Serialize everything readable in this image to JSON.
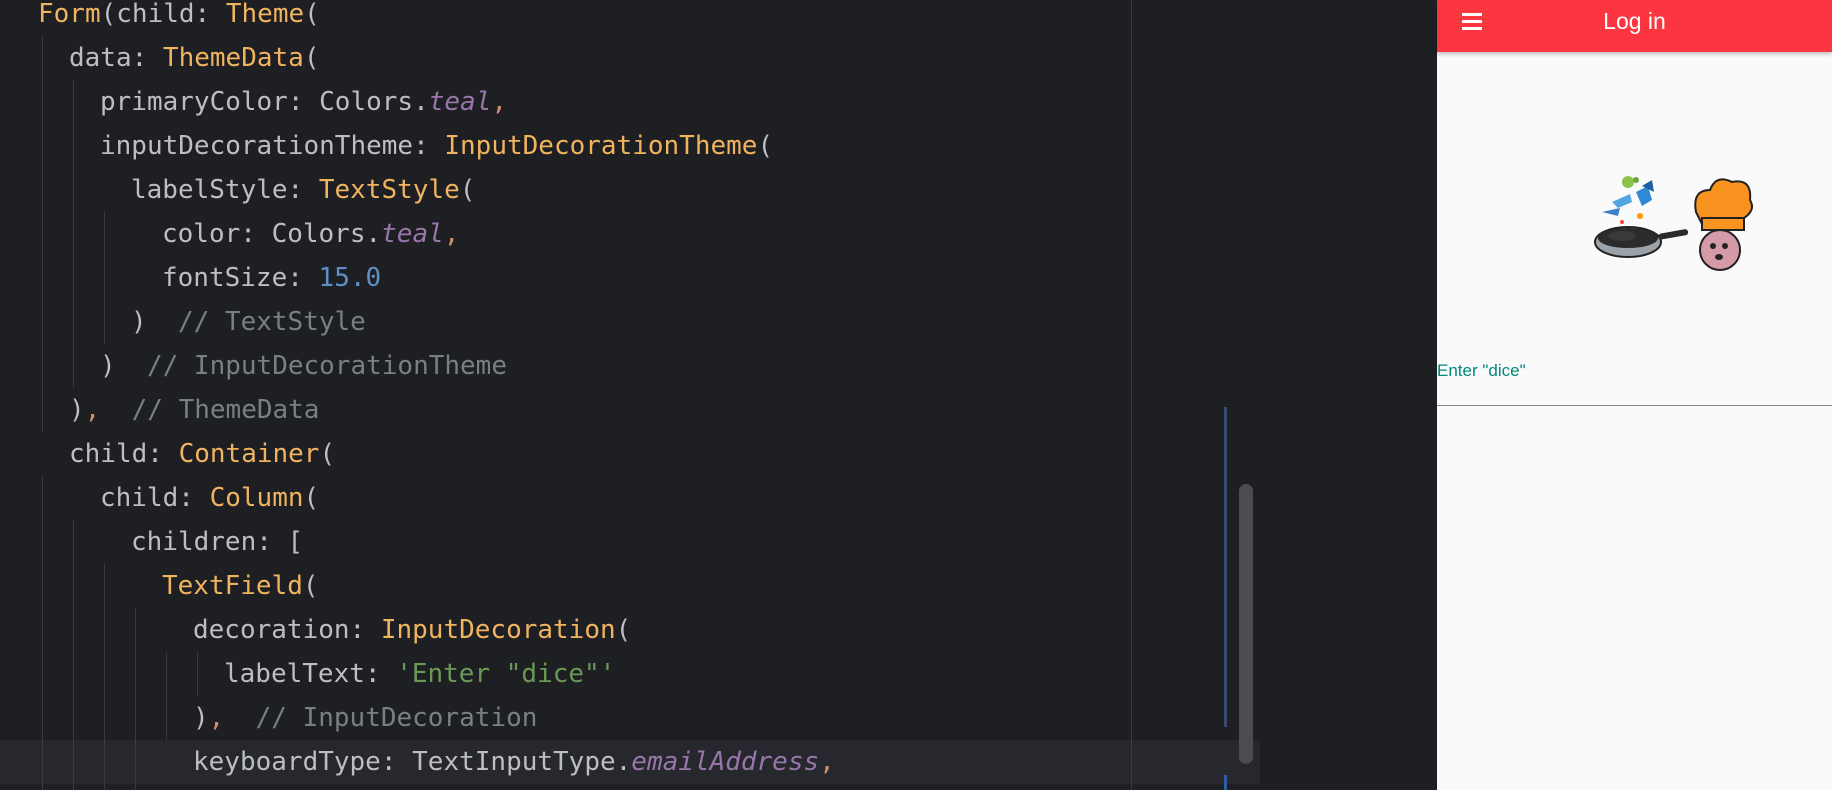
{
  "editor": {
    "lines": [
      {
        "tokens": [
          {
            "t": "Form",
            "c": "class"
          },
          {
            "t": "(",
            "c": "punc"
          },
          {
            "t": "child: ",
            "c": "ident"
          },
          {
            "t": "Theme",
            "c": "class"
          },
          {
            "t": "(",
            "c": "punc"
          }
        ]
      },
      {
        "tokens": [
          {
            "t": "data: ",
            "c": "ident"
          },
          {
            "t": "ThemeData",
            "c": "class"
          },
          {
            "t": "(",
            "c": "punc"
          }
        ]
      },
      {
        "tokens": [
          {
            "t": "primaryColor: Colors.",
            "c": "ident"
          },
          {
            "t": "teal",
            "c": "italic"
          },
          {
            "t": ",",
            "c": "comma"
          }
        ]
      },
      {
        "tokens": [
          {
            "t": "inputDecorationTheme: ",
            "c": "ident"
          },
          {
            "t": "InputDecorationTheme",
            "c": "class"
          },
          {
            "t": "(",
            "c": "punc"
          }
        ]
      },
      {
        "tokens": [
          {
            "t": "labelStyle: ",
            "c": "ident"
          },
          {
            "t": "TextStyle",
            "c": "class"
          },
          {
            "t": "(",
            "c": "punc"
          }
        ]
      },
      {
        "tokens": [
          {
            "t": "color: Colors.",
            "c": "ident"
          },
          {
            "t": "teal",
            "c": "italic"
          },
          {
            "t": ",",
            "c": "comma"
          }
        ]
      },
      {
        "tokens": [
          {
            "t": "fontSize: ",
            "c": "ident"
          },
          {
            "t": "15.0",
            "c": "number"
          }
        ]
      },
      {
        "tokens": [
          {
            "t": ")",
            "c": "punc"
          },
          {
            "t": "  // TextStyle",
            "c": "comment"
          }
        ]
      },
      {
        "tokens": [
          {
            "t": ")",
            "c": "punc"
          },
          {
            "t": "  // InputDecorationTheme",
            "c": "comment"
          }
        ]
      },
      {
        "tokens": [
          {
            "t": ")",
            "c": "punc"
          },
          {
            "t": ",",
            "c": "comma"
          },
          {
            "t": "  // ThemeData",
            "c": "comment"
          }
        ]
      },
      {
        "tokens": [
          {
            "t": "child: ",
            "c": "ident"
          },
          {
            "t": "Container",
            "c": "class"
          },
          {
            "t": "(",
            "c": "punc"
          }
        ]
      },
      {
        "tokens": [
          {
            "t": "child: ",
            "c": "ident"
          },
          {
            "t": "Column",
            "c": "class"
          },
          {
            "t": "(",
            "c": "punc"
          }
        ]
      },
      {
        "tokens": [
          {
            "t": "children: [",
            "c": "ident"
          }
        ]
      },
      {
        "tokens": [
          {
            "t": "TextField",
            "c": "class"
          },
          {
            "t": "(",
            "c": "punc"
          }
        ]
      },
      {
        "tokens": [
          {
            "t": "decoration: ",
            "c": "ident"
          },
          {
            "t": "InputDecoration",
            "c": "class"
          },
          {
            "t": "(",
            "c": "punc"
          }
        ]
      },
      {
        "tokens": [
          {
            "t": "labelText: ",
            "c": "ident"
          },
          {
            "t": "'Enter \"dice\"'",
            "c": "string"
          }
        ]
      },
      {
        "tokens": [
          {
            "t": ")",
            "c": "punc"
          },
          {
            "t": ",",
            "c": "comma"
          },
          {
            "t": "  // InputDecoration",
            "c": "comment"
          }
        ]
      },
      {
        "tokens": [
          {
            "t": "keyboardType: TextInputType.",
            "c": "ident"
          },
          {
            "t": "emailAddress",
            "c": "italic"
          },
          {
            "t": ",",
            "c": "comma"
          }
        ]
      }
    ],
    "colors": {
      "background": "#1e1f22",
      "class": "#f0b35f",
      "italic": "#9876aa",
      "number": "#5f8fc5",
      "comment": "#7a7e85",
      "string": "#6a9955"
    }
  },
  "preview": {
    "appbar": {
      "title": "Log in",
      "menu_icon": "hamburger-menu-icon",
      "color": "#fb3641"
    },
    "logo": {
      "icon": "cooking-mascot-illustration"
    },
    "field": {
      "label": "Enter \"dice\"",
      "label_color": "#00897b"
    }
  }
}
